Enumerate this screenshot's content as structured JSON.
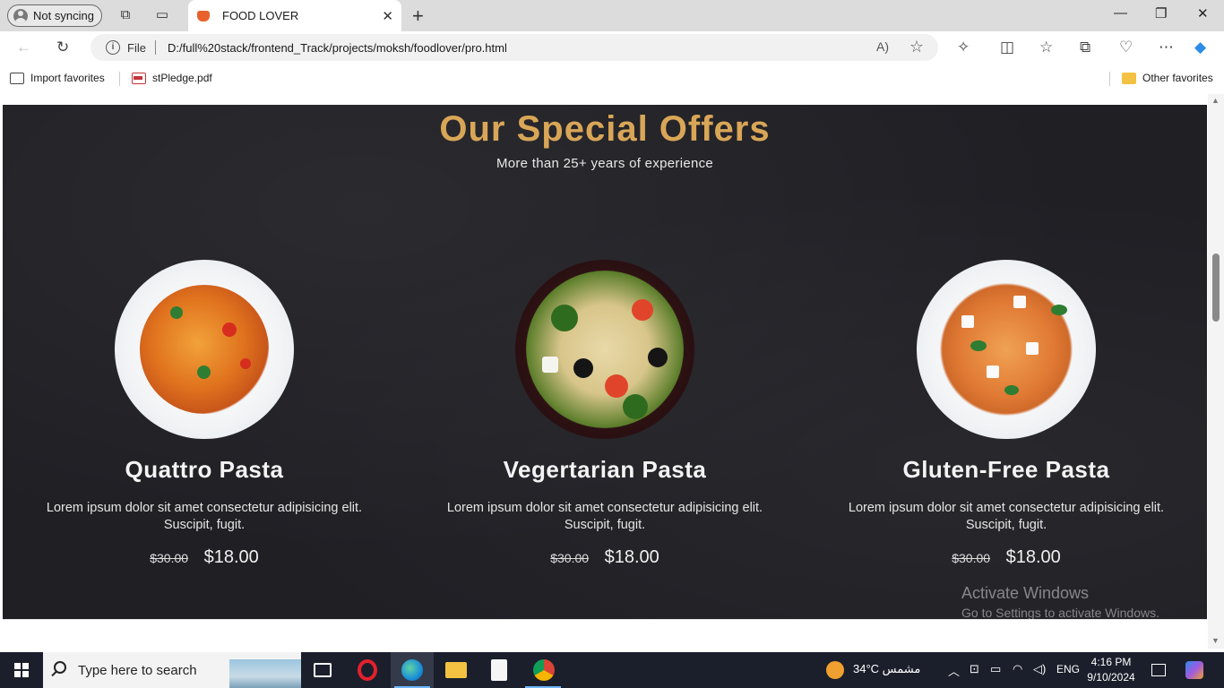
{
  "browser": {
    "profile_label": "Not syncing",
    "tab_title": "FOOD LOVER",
    "omnibox_scheme": "File",
    "url": "D:/full%20stack/frontend_Track/projects/moksh/foodlover/pro.html",
    "favorites": {
      "import": "Import favorites",
      "pdf": "stPledge.pdf",
      "other": "Other favorites"
    }
  },
  "page": {
    "heading": "Our Special Offers",
    "subheading": "More than 25+ years of experience",
    "cards": [
      {
        "title": "Quattro Pasta",
        "description": "Lorem ipsum dolor sit amet consectetur adipisicing elit. Suscipit, fugit.",
        "old_price": "$30.00",
        "price": "$18.00"
      },
      {
        "title": "Vegertarian Pasta",
        "description": "Lorem ipsum dolor sit amet consectetur adipisicing elit. Suscipit, fugit.",
        "old_price": "$30.00",
        "price": "$18.00"
      },
      {
        "title": "Gluten-Free Pasta",
        "description": "Lorem ipsum dolor sit amet consectetur adipisicing elit. Suscipit, fugit.",
        "old_price": "$30.00",
        "price": "$18.00"
      }
    ]
  },
  "watermark": {
    "line1": "Activate Windows",
    "line2": "Go to Settings to activate Windows."
  },
  "taskbar": {
    "search_placeholder": "Type here to search",
    "weather": "34°C  مشمس",
    "language": "ENG",
    "time": "4:16 PM",
    "date": "9/10/2024"
  },
  "colors": {
    "accent": "#d9a657",
    "page_bg": "#1f1f24"
  }
}
